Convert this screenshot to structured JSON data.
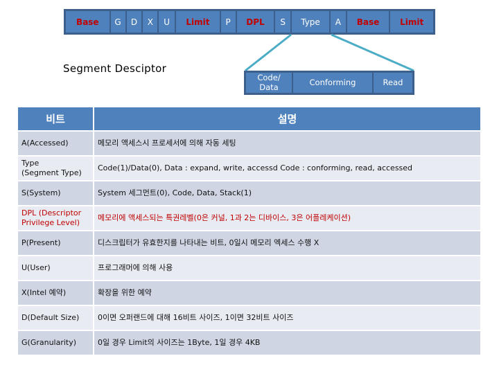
{
  "top_bar": {
    "segments": [
      {
        "label": "Base",
        "highlight": true
      },
      {
        "label": "G",
        "highlight": false
      },
      {
        "label": "D",
        "highlight": false
      },
      {
        "label": "X",
        "highlight": false
      },
      {
        "label": "U",
        "highlight": false
      },
      {
        "label": "Limit",
        "highlight": true
      },
      {
        "label": "P",
        "highlight": false
      },
      {
        "label": "DPL",
        "highlight": true
      },
      {
        "label": "S",
        "highlight": false
      },
      {
        "label": "Type",
        "highlight": false
      },
      {
        "label": "A",
        "highlight": false
      },
      {
        "label": "Base",
        "highlight": true
      },
      {
        "label": "Limit",
        "highlight": true
      }
    ]
  },
  "descriptor_title": "Segment Desciptor",
  "type_breakdown": {
    "segments": [
      {
        "label": "Code/\nData"
      },
      {
        "label": "Conforming"
      },
      {
        "label": "Read"
      }
    ]
  },
  "colors": {
    "header": "#4f81bd",
    "highlight_text": "#c00000",
    "connector": "#4bacc6"
  },
  "table": {
    "headers": [
      "비트",
      "설명"
    ],
    "rows": [
      {
        "bit": "A(Accessed)",
        "desc": "메모리 액세스시 프로세서에 의해 자동 세팅",
        "highlight": false
      },
      {
        "bit": "Type\n(Segment Type)",
        "desc": "Code(1)/Data(0), Data : expand, write, accessd Code : conforming, read, accessed",
        "highlight": false
      },
      {
        "bit": "S(System)",
        "desc": "System 세그먼트(0), Code, Data, Stack(1)",
        "highlight": false
      },
      {
        "bit": "DPL (Descriptor\nPrivilege Level)",
        "desc": "메모리에 액세스되는 특권레벨(0은 커널, 1과 2는 디바이스, 3은 어플레케이션)",
        "highlight": true
      },
      {
        "bit": "P(Present)",
        "desc": "디스크립터가 유효한지를 나타내는 비트, 0일시 메모리 엑세스 수행 X",
        "highlight": false
      },
      {
        "bit": "U(User)",
        "desc": "프로그래머에 의해 사용",
        "highlight": false
      },
      {
        "bit": "X(Intel 예약)",
        "desc": "확장을 위한 예약",
        "highlight": false
      },
      {
        "bit": "D(Default Size)",
        "desc": "0이면 오퍼랜드에 대해 16비트 사이즈, 1이면 32비트 사이즈",
        "highlight": false
      },
      {
        "bit": "G(Granularity)",
        "desc": "0일 경우 Limit의 사이즈는 1Byte, 1일 경우 4KB",
        "highlight": false
      }
    ]
  }
}
